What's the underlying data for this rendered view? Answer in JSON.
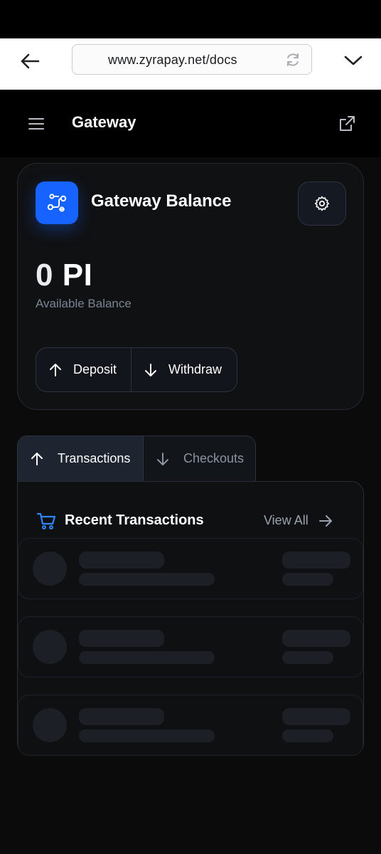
{
  "browser": {
    "url": "www.zyrapay.net/docs"
  },
  "header": {
    "title": "Gateway"
  },
  "balance_card": {
    "title": "Gateway Balance",
    "amount_number": "0",
    "amount_unit": "PI",
    "label": "Available Balance",
    "deposit_label": "Deposit",
    "withdraw_label": "Withdraw",
    "accent_color": "#1763ff"
  },
  "tabs": [
    {
      "label": "Transactions",
      "active": true
    },
    {
      "label": "Checkouts",
      "active": false
    }
  ],
  "transactions": {
    "title": "Recent Transactions",
    "view_all_label": "View All",
    "loading_placeholders": 3
  },
  "icons": {
    "back": "arrow-left-icon",
    "reload": "reload-icon",
    "menu": "chevron-down-icon",
    "hamburger": "hamburger-icon",
    "external": "external-link-icon",
    "logo": "route-icon",
    "settings": "gear-icon",
    "deposit": "arrow-up-icon",
    "withdraw": "arrow-down-icon",
    "cart": "cart-icon",
    "view_all": "arrow-right-icon"
  }
}
